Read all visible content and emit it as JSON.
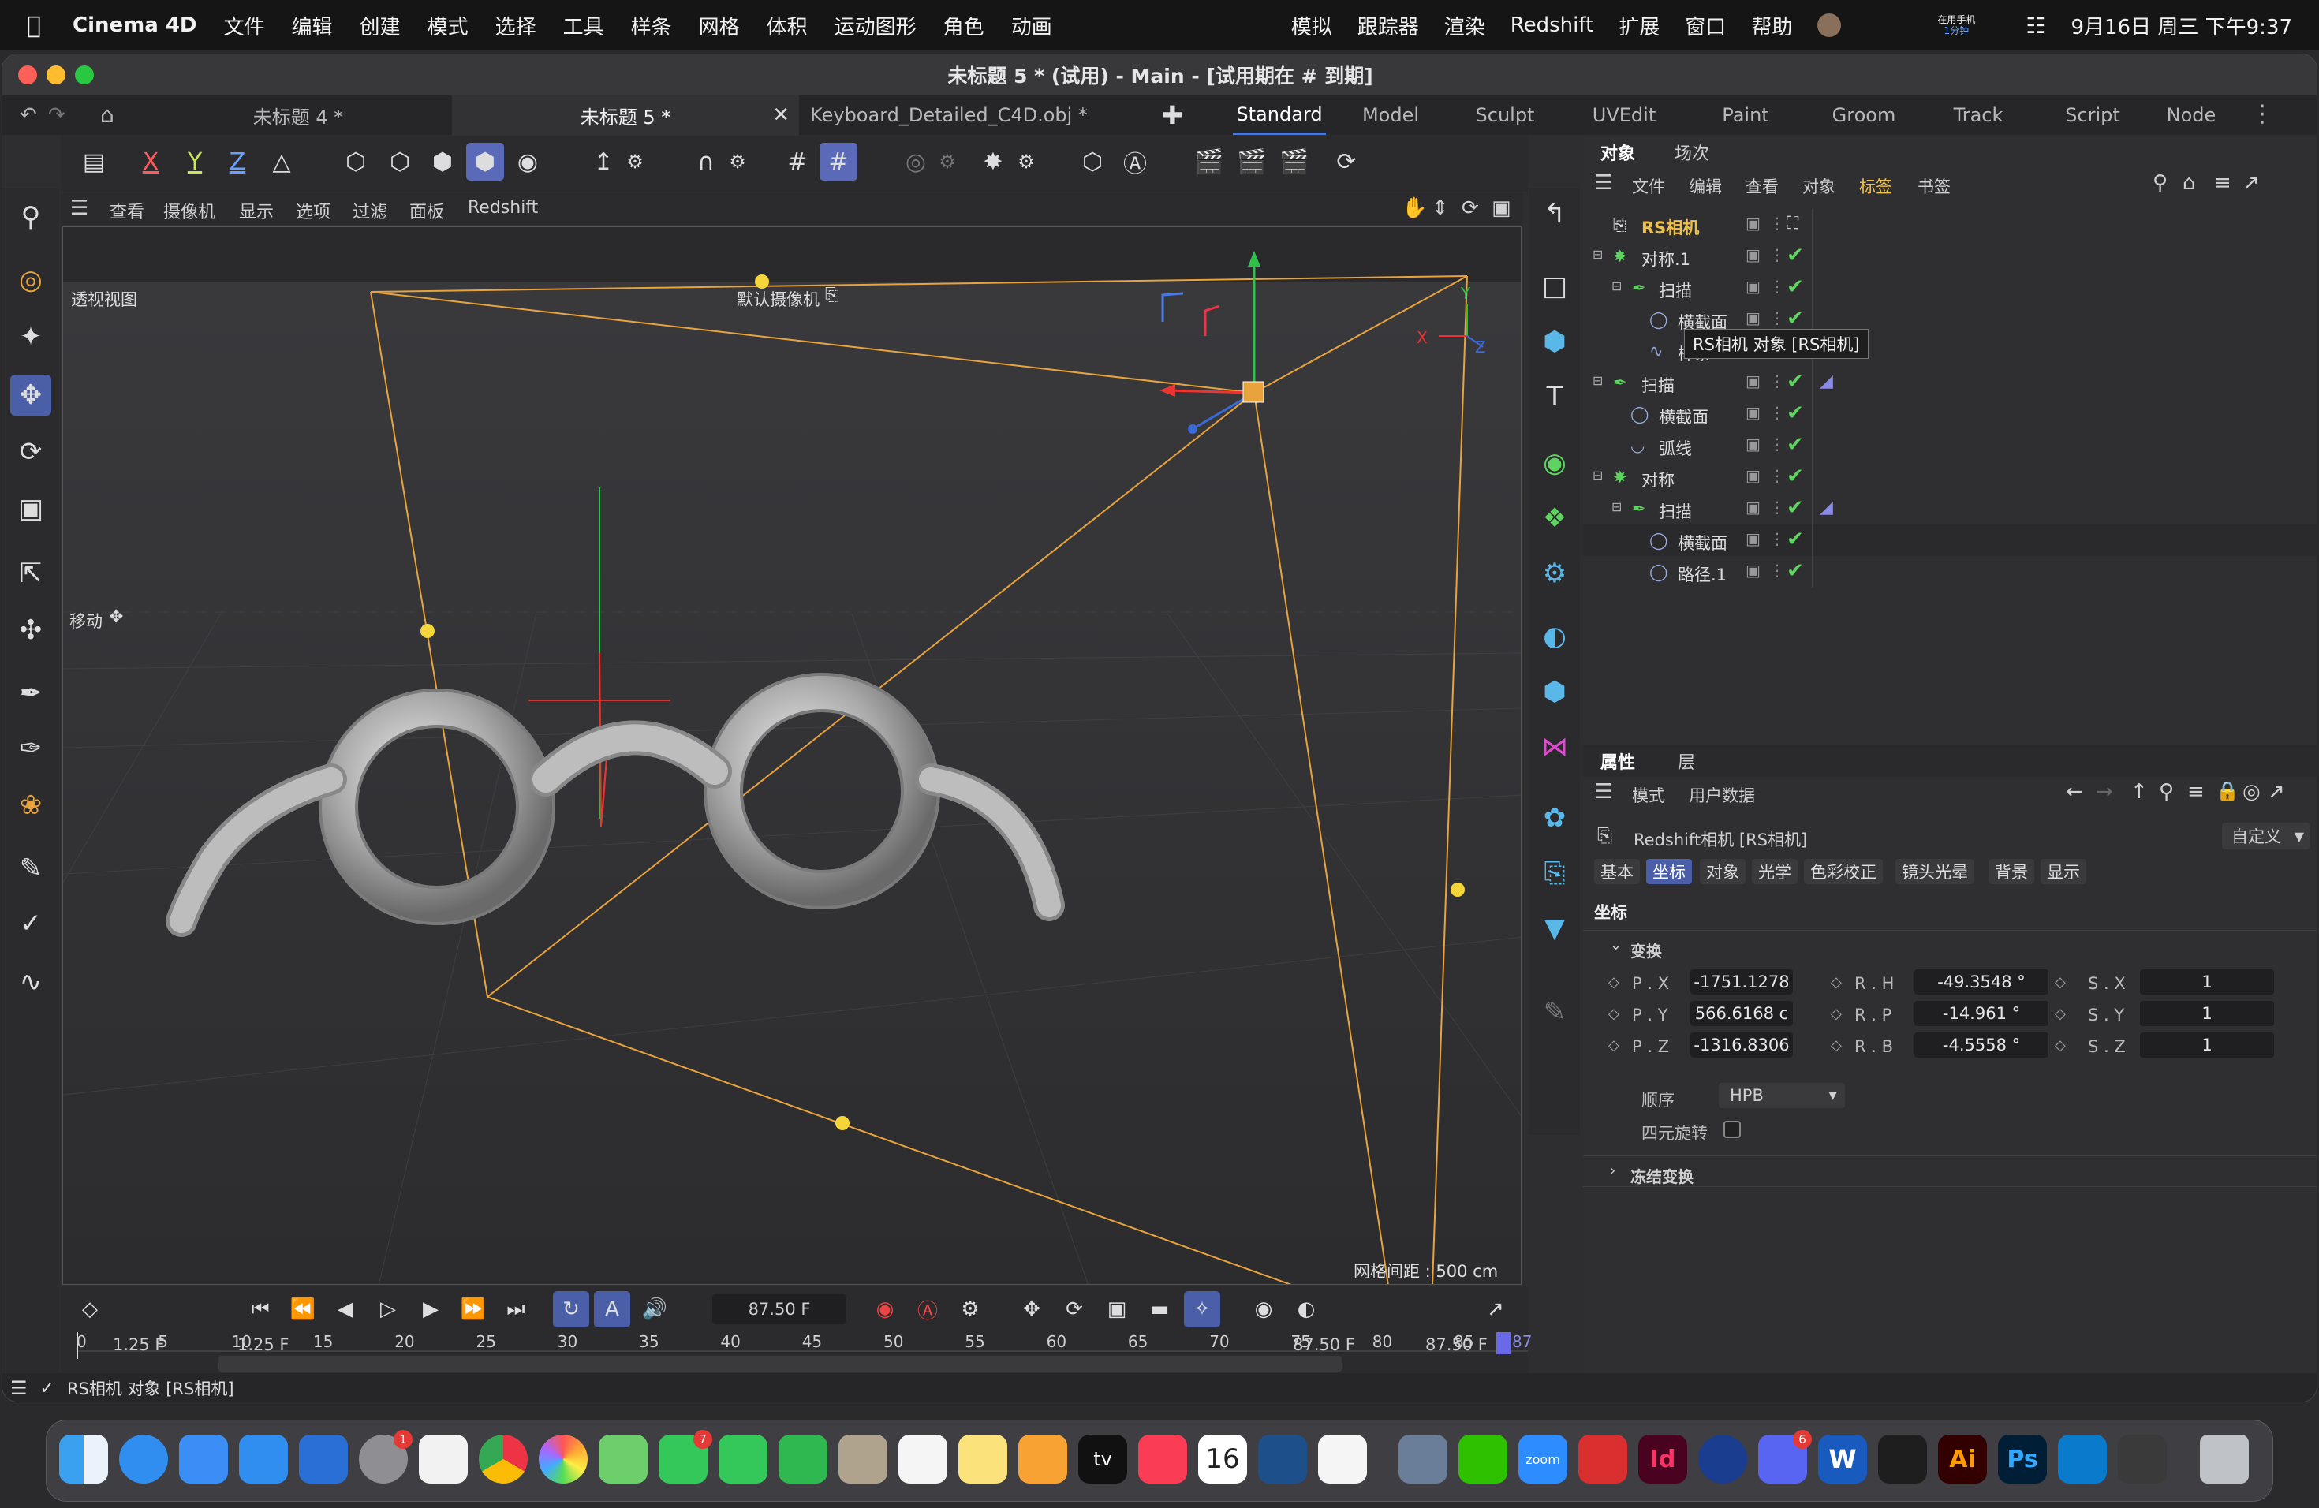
{
  "menubar": {
    "app_name": "Cinema 4D",
    "items": [
      "文件",
      "编辑",
      "创建",
      "模式",
      "选择",
      "工具",
      "样条",
      "网格",
      "体积",
      "运动图形",
      "角色",
      "动画"
    ],
    "right_items": [
      "模拟",
      "跟踪器",
      "渲染",
      "Redshift",
      "扩展",
      "窗口",
      "帮助"
    ],
    "phone_label": "在用手机",
    "phone_time": "1分钟",
    "datetime": "9月16日 周三  下午9:37"
  },
  "window": {
    "title": "未标题 5 * (试用) - Main - [试用期在 # 到期]",
    "doc_tabs": [
      "未标题 4 *",
      "未标题 5 *",
      "Keyboard_Detailed_C4D.obj *"
    ],
    "active_doc_tab": 1,
    "layouts": [
      "Standard",
      "Model",
      "Sculpt",
      "UVEdit",
      "Paint",
      "Groom",
      "Track",
      "Script",
      "Node"
    ],
    "active_layout": 0
  },
  "top_toolbar": {
    "axis_x": "X",
    "axis_y": "Y",
    "axis_z": "Z"
  },
  "viewport": {
    "menu": [
      "查看",
      "摄像机",
      "显示",
      "选项",
      "过滤",
      "面板",
      "Redshift"
    ],
    "view_name": "透视视图",
    "camera_name": "默认摄像机",
    "tool_label": "移动",
    "grid_spacing": "网格间距 : 500 cm",
    "axis_x": "X",
    "axis_y": "Y",
    "axis_z": "Z"
  },
  "object_panel": {
    "tabs": [
      "对象",
      "场次"
    ],
    "menu": [
      "文件",
      "编辑",
      "查看",
      "对象",
      "标签",
      "书签"
    ],
    "tooltip": "RS相机 对象 [RS相机]",
    "items": [
      {
        "name": "RS相机",
        "indent": 0,
        "type": "camera"
      },
      {
        "name": "对称.1",
        "indent": 0,
        "type": "symmetry"
      },
      {
        "name": "扫描",
        "indent": 1,
        "type": "sweep"
      },
      {
        "name": "横截面",
        "indent": 2,
        "type": "circle"
      },
      {
        "name": "样条",
        "indent": 2,
        "type": "spline"
      },
      {
        "name": "扫描",
        "indent": 0,
        "type": "sweep"
      },
      {
        "name": "横截面",
        "indent": 1,
        "type": "circle"
      },
      {
        "name": "弧线",
        "indent": 1,
        "type": "arc"
      },
      {
        "name": "对称",
        "indent": 0,
        "type": "symmetry"
      },
      {
        "name": "扫描",
        "indent": 1,
        "type": "sweep"
      },
      {
        "name": "横截面",
        "indent": 2,
        "type": "circle"
      },
      {
        "name": "路径.1",
        "indent": 2,
        "type": "circle"
      }
    ]
  },
  "attr_panel": {
    "tabs": [
      "属性",
      "层"
    ],
    "menu": [
      "模式",
      "用户数据"
    ],
    "object_title": "Redshift相机 [RS相机]",
    "preset": "自定义",
    "sub_tabs": [
      "基本",
      "坐标",
      "对象",
      "光学",
      "色彩校正",
      "镜头光晕",
      "背景",
      "显示"
    ],
    "active_sub_tab": 1,
    "section_title": "坐标",
    "group_transform": "变换",
    "fields": {
      "px_label": "P . X",
      "px": "-1751.1278",
      "py_label": "P . Y",
      "py": "566.6168 c",
      "pz_label": "P . Z",
      "pz": "-1316.8306",
      "rh_label": "R . H",
      "rh": "-49.3548 °",
      "rp_label": "R . P",
      "rp": "-14.961 °",
      "rb_label": "R . B",
      "rb": "-4.5558 °",
      "sx_label": "S . X",
      "sx": "1",
      "sy_label": "S . Y",
      "sy": "1",
      "sz_label": "S . Z",
      "sz": "1"
    },
    "order_label": "顺序",
    "order_value": "HPB",
    "quat_label": "四元旋转",
    "group_freeze": "冻结变换"
  },
  "timeline": {
    "current_frame": "87.50 F",
    "ticks": [
      "0",
      "5",
      "10",
      "15",
      "20",
      "25",
      "30",
      "35",
      "40",
      "45",
      "50",
      "55",
      "60",
      "65",
      "70",
      "75",
      "80",
      "85"
    ],
    "end_tick": "87",
    "range_start": "1.25 F",
    "range_start2": "1.25 F",
    "range_end": "87.50 F",
    "range_end2": "87.50 F"
  },
  "status": {
    "text": "RS相机 对象 [RS相机]"
  },
  "dock": {
    "calendar_day": "16",
    "tv_label": "tv",
    "zoom_label": "zoom",
    "id_label": "Id",
    "ai_label": "Ai",
    "ps_label": "Ps",
    "word_label": "W",
    "badges": {
      "settings": "1",
      "messages": "7",
      "discord": "6"
    }
  }
}
